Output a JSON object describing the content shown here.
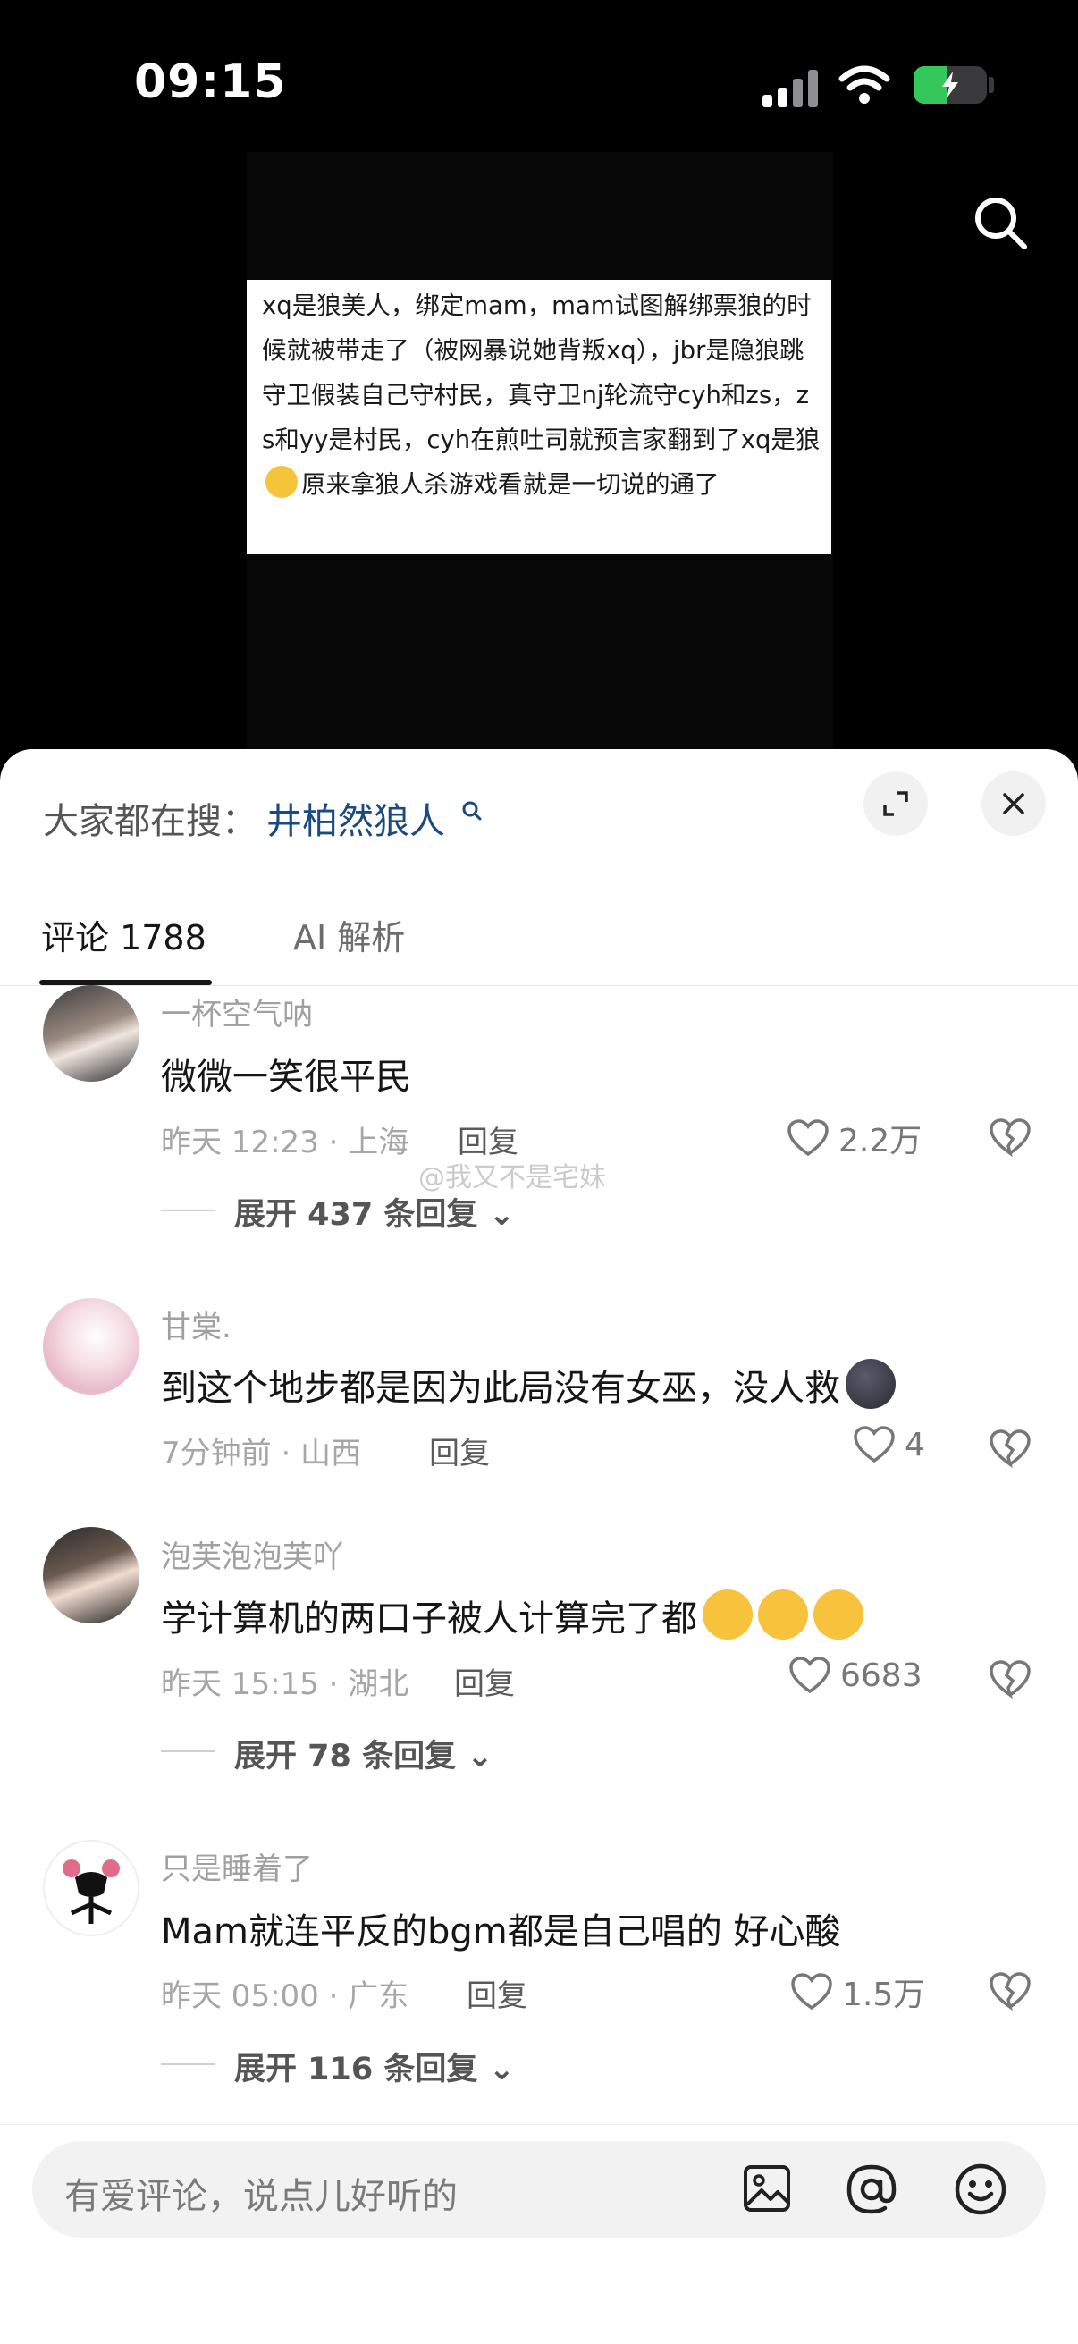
{
  "status_bar": {
    "time": "09:15",
    "battery_level": 0.45,
    "icons": [
      "signal-icon",
      "wifi-icon",
      "battery-charging-icon"
    ]
  },
  "video": {
    "search_icon": "search-icon",
    "caption": "xq是狼美人，绑定mam，mam试图解绑票狼的时候就被带走了（被网暴说她背叛xq），jbr是隐狼跳守卫假装自己守村民，真守卫nj轮流守cyh和zs，zs和yy是村民，cyh在煎吐司就预言家翻到了xq是狼",
    "caption_tail": "原来拿狼人杀游戏看就是一切说的通了"
  },
  "sheet": {
    "search_prefix": "大家都在搜：",
    "search_keyword": "井柏然狼人",
    "expand_icon": "expand-icon",
    "close_icon": "close-icon"
  },
  "tabs": [
    {
      "label": "评论 1788",
      "active": true
    },
    {
      "label": "AI 解析",
      "active": false
    }
  ],
  "comments": [
    {
      "name": "一杯空气呐",
      "text": "微微一笑很平民",
      "meta": "昨天 12:23 · 上海",
      "reply": "回复",
      "likes": "2.2万",
      "expand": "展开 437 条回复"
    },
    {
      "name": "甘棠.",
      "text": "到这个地步都是因为此局没有女巫，没人救",
      "meta": "7分钟前 · 山西",
      "reply": "回复",
      "likes": "4"
    },
    {
      "name": "泡芙泡泡芙吖",
      "text": "学计算机的两口子被人计算完了都",
      "meta": "昨天 15:15 · 湖北",
      "reply": "回复",
      "likes": "6683",
      "expand": "展开 78 条回复"
    },
    {
      "name": "只是睡着了",
      "text": "Mam就连平反的bgm都是自己唱的 好心酸",
      "meta": "昨天 05:00 · 广东",
      "reply": "回复",
      "likes": "1.5万",
      "expand": "展开 116 条回复"
    }
  ],
  "watermark": "@我又不是宅妹",
  "input": {
    "placeholder": "有爱评论，说点儿好听的",
    "icons": [
      "image-icon",
      "at-icon",
      "emoji-icon"
    ]
  },
  "colors": {
    "keyword_blue": "#1a4a80",
    "battery_green": "#34c759"
  }
}
